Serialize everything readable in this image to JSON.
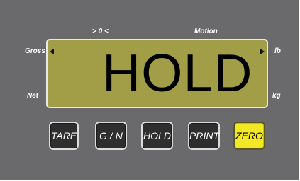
{
  "indicators": {
    "center_of_zero": "> 0 <",
    "motion": "Motion",
    "gross": "Gross",
    "net": "Net",
    "lb": "lb",
    "kg": "kg"
  },
  "display": {
    "text": "HOLD"
  },
  "keys": {
    "tare": "TARE",
    "gross_net": "G / N",
    "hold": "HOLD",
    "print": "PRINT",
    "zero": "ZERO"
  },
  "colors": {
    "panel": "#6a6a6c",
    "lcd": "#a29e48",
    "key": "#2e2e2e",
    "zero_key": "#f2e825"
  }
}
